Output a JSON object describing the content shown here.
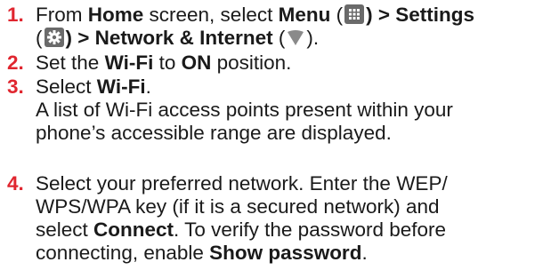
{
  "steps": [
    {
      "number": "1.",
      "t1": "From ",
      "home": "Home",
      "t2": " screen, select ",
      "menu": "Menu",
      "t3": " (",
      "t4": ") > Settings",
      "t5": "(",
      "t6": ") > ",
      "network": "Network & Internet",
      "t7": " (",
      "t8": ")."
    },
    {
      "number": "2.",
      "t1": "Set the ",
      "wifi": "Wi-Fi",
      "t2": " to ",
      "on": "ON",
      "t3": " position."
    },
    {
      "number": "3.",
      "t1": "Select ",
      "wifi": "Wi-Fi",
      "t2": ".",
      "desc_line1": "A list of Wi-Fi access points present within your",
      "desc_line2": "phone’s accessible range are displayed."
    },
    {
      "number": "4.",
      "line1": "Select your preferred network. Enter the WEP/",
      "line2": "WPS/WPA key (if it is a secured network) and",
      "t1": "select ",
      "connect": "Connect",
      "t2": ". To verify the password before",
      "t3": "connecting, enable ",
      "show_password": "Show password",
      "t4": "."
    }
  ],
  "colors": {
    "step_number": "#e0262f",
    "icon_bg": "#6a6a6a",
    "text": "#1a1a1a"
  },
  "icons": [
    "menu-grid-icon",
    "settings-gear-icon",
    "wifi-signal-icon"
  ]
}
